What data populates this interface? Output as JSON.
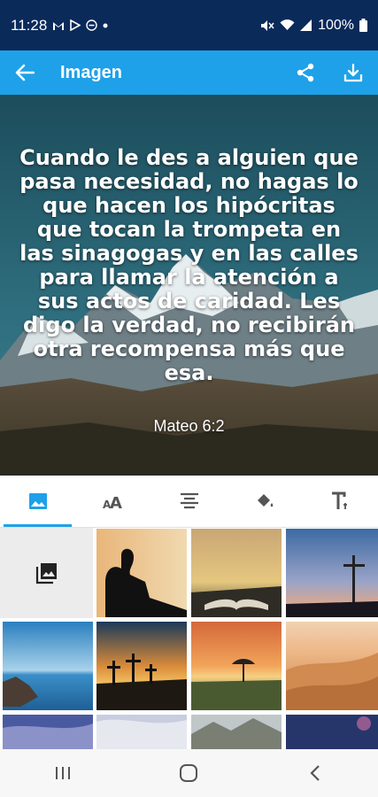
{
  "status_bar": {
    "time": "11:28",
    "battery": "100%"
  },
  "app_bar": {
    "title": "Imagen"
  },
  "preview": {
    "quote": "Cuando le des a alguien que pasa necesidad, no hagas lo que hacen los hipócritas que tocan la trompeta en las sinagogas y en las calles para llamar la atención a sus actos de caridad. Les digo la verdad, no recibirán otra recompensa más que esa.",
    "reference": "Mateo 6:2"
  },
  "tabs": [
    {
      "icon": "image-icon",
      "active": true
    },
    {
      "icon": "font-size-icon",
      "active": false
    },
    {
      "icon": "align-center-icon",
      "active": false
    },
    {
      "icon": "fill-color-icon",
      "active": false
    },
    {
      "icon": "text-format-icon",
      "active": false
    }
  ],
  "gallery": {
    "items": [
      "gallery-picker",
      "child-reading-silhouette",
      "open-bible-sunset",
      "cross-twilight",
      "blue-lake",
      "three-crosses-sunset",
      "savanna-tree-sunset",
      "desert-dunes",
      "purple-sky",
      "soft-clouds",
      "mountain-field",
      "night-sky"
    ]
  },
  "colors": {
    "status_bar": "#0a2a5a",
    "app_bar": "#1ea1e8",
    "accent": "#1ea1e8"
  }
}
